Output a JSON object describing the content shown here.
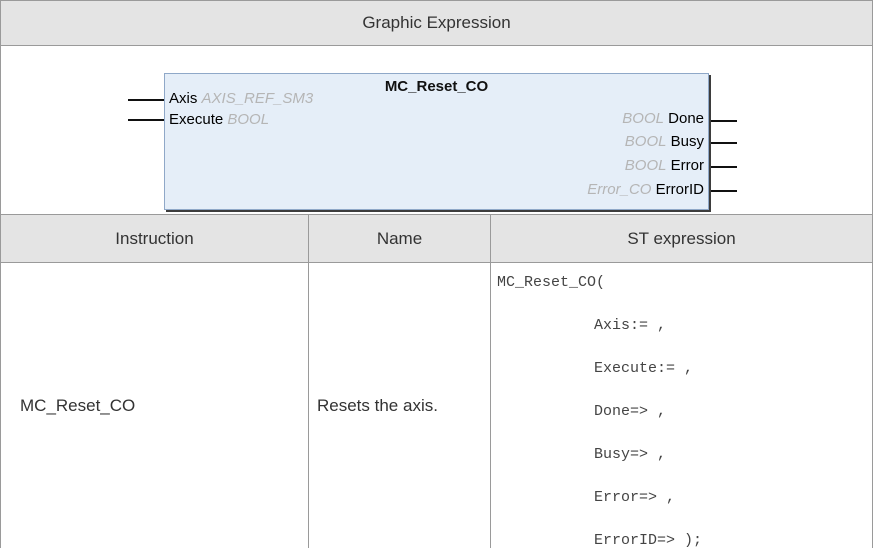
{
  "header": {
    "title": "Graphic Expression"
  },
  "function_block": {
    "name": "MC_Reset_CO",
    "inputs": [
      {
        "name": "Axis",
        "type": "AXIS_REF_SM3"
      },
      {
        "name": "Execute",
        "type": "BOOL"
      }
    ],
    "outputs": [
      {
        "name": "Done",
        "type": "BOOL"
      },
      {
        "name": "Busy",
        "type": "BOOL"
      },
      {
        "name": "Error",
        "type": "BOOL"
      },
      {
        "name": "ErrorID",
        "type": "Error_CO"
      }
    ]
  },
  "table": {
    "columns": [
      "Instruction",
      "Name",
      "ST expression"
    ],
    "row": {
      "instruction": "MC_Reset_CO",
      "name": "Resets the axis.",
      "st_expression": [
        "MC_Reset_CO(",
        "Axis:= ,",
        "Execute:= ,",
        "Done=> ,",
        "Busy=> ,",
        "Error=> ,",
        "ErrorID=> );"
      ]
    }
  }
}
